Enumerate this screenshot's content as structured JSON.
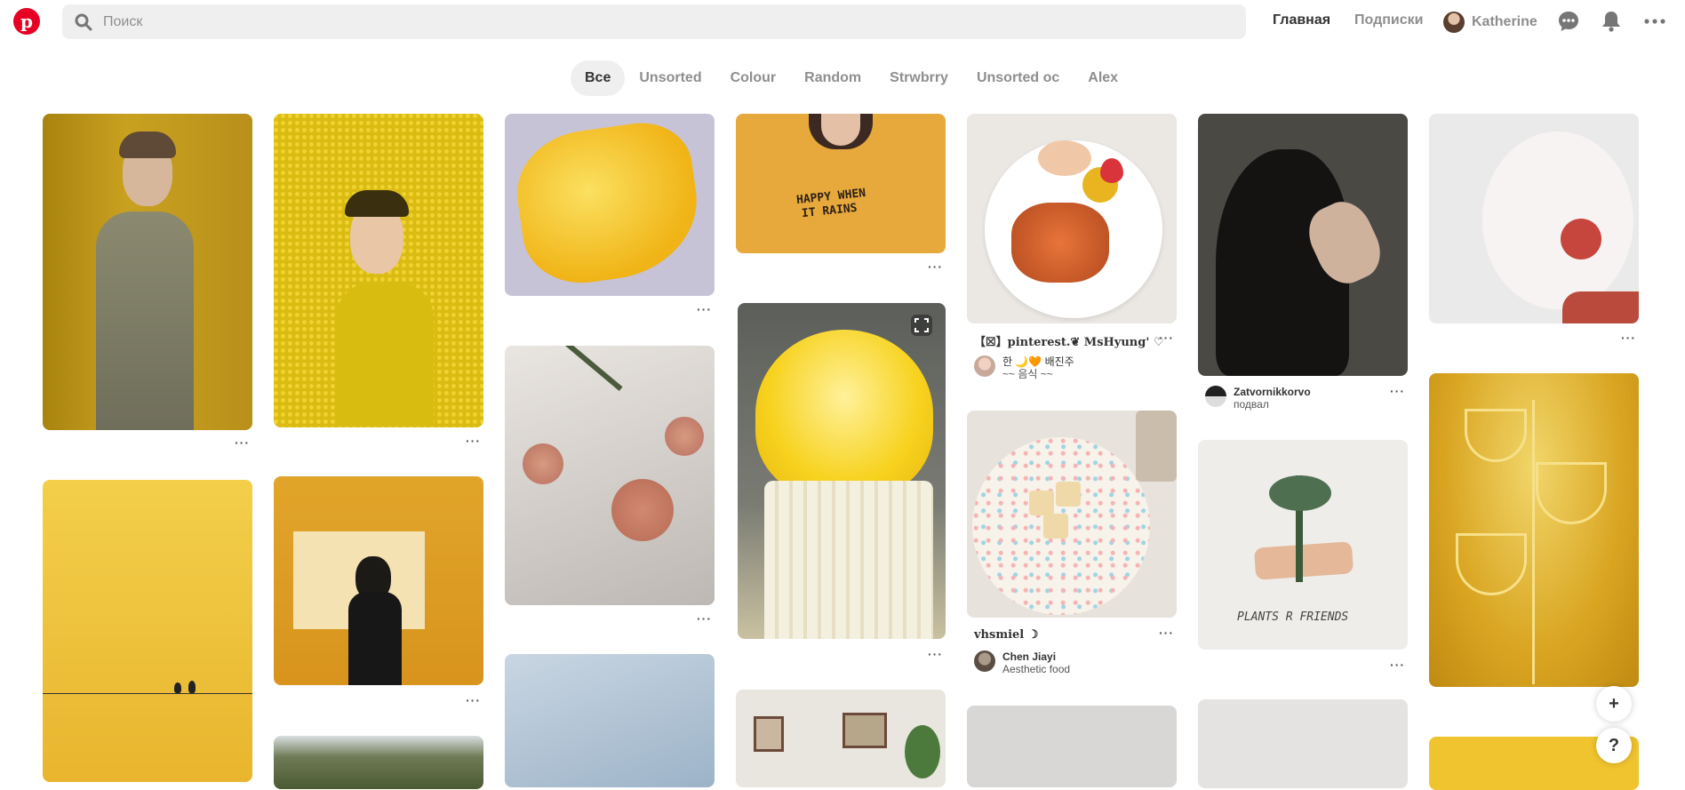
{
  "search": {
    "placeholder": "Поиск"
  },
  "nav": {
    "home": "Главная",
    "following": "Подписки",
    "user": "Katherine"
  },
  "icons": {
    "logo": "pinterest-logo-icon",
    "search": "search-icon",
    "messages": "chat-bubble-icon",
    "notifications": "bell-icon",
    "more": "more-dots-icon"
  },
  "tabs": [
    "Все",
    "Unsorted",
    "Colour",
    "Random",
    "Strwbrry",
    "Unsorted oc",
    "Alex"
  ],
  "pins": {
    "more_label": "···",
    "sweatshirt_text_1": "HAPPY WHEN",
    "sweatshirt_text_2": "IT RAINS",
    "food_title": "【☒】pinterest.❦ MsHyung' ♡",
    "food_user": "한 🌙🧡 배진주",
    "food_board": "~~ 음식 ~~",
    "dog_user": "Zatvornikkorvo",
    "dog_board": "подвал",
    "plate_title": "vhsmiel ☽",
    "plate_user": "Chen Jiayi",
    "plate_board": "Aesthetic food",
    "plant_caption": "PLANTS R FRIENDS"
  },
  "fab": {
    "add": "+",
    "help": "?"
  },
  "colors": {
    "brand": "#e60023",
    "active_tab_bg": "#efefef",
    "muted_text": "#8e8e8e"
  }
}
